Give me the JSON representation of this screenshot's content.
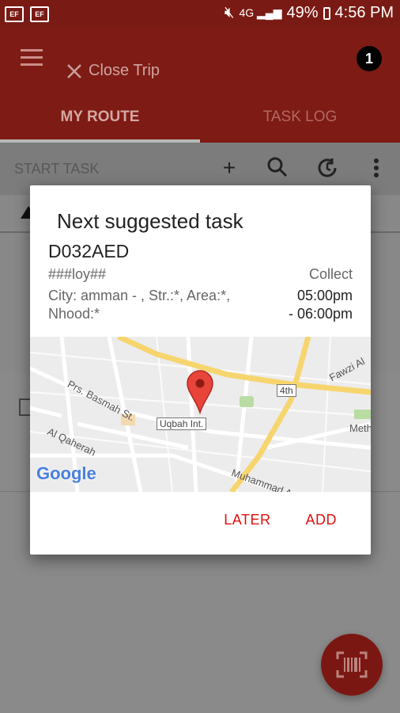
{
  "status_bar": {
    "battery": "49%",
    "time": "4:56 PM"
  },
  "app_bar": {
    "close_trip_label": "Close Trip",
    "notification_count": "1"
  },
  "tabs": [
    {
      "label": "MY ROUTE",
      "active": true
    },
    {
      "label": "TASK LOG",
      "active": false
    }
  ],
  "toolbar": {
    "start_task_label": "START TASK"
  },
  "dialog": {
    "title": "Next suggested task",
    "code": "D032AED",
    "name": "###loy##",
    "type": "Collect",
    "address_line1": "City: amman - , Str.:*, Area:*,",
    "address_line2": "Nhood:*",
    "time_from": "05:00pm",
    "time_to": "- 06:00pm",
    "map": {
      "labels": [
        "Prs. Basmah St.",
        "Uqbah Int.",
        "4th",
        "Al Qaherah",
        "Muhammad A",
        "Fawzi Al",
        "Meth",
        "Google"
      ]
    },
    "later_label": "LATER",
    "add_label": "ADD"
  },
  "colors": {
    "accent": "#e01010",
    "app_bar": "#7e1b15"
  }
}
